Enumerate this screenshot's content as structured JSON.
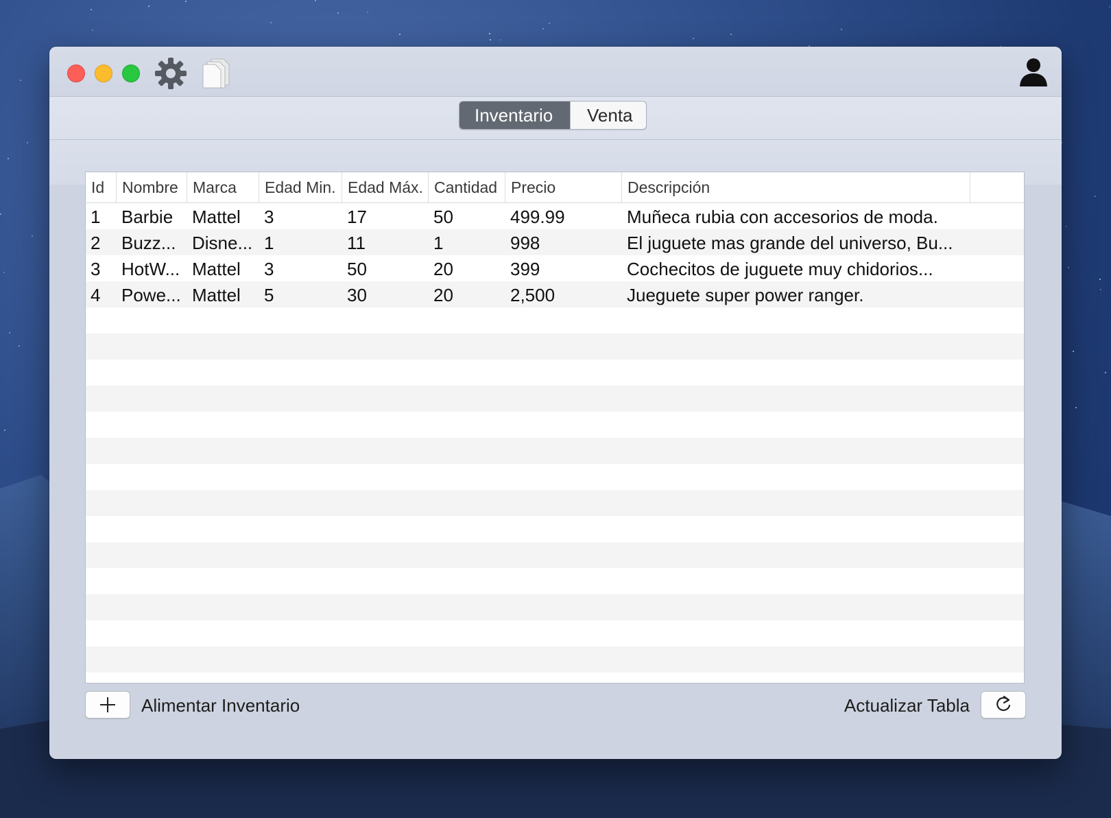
{
  "window": {
    "tabs": [
      {
        "label": "Inventario",
        "selected": true
      },
      {
        "label": "Venta",
        "selected": false
      }
    ]
  },
  "toolbar_icons": [
    "gear-icon",
    "documents-icon",
    "user-icon"
  ],
  "table": {
    "columns": [
      "Id",
      "Nombre",
      "Marca",
      "Edad Min.",
      "Edad Máx.",
      "Cantidad",
      "Precio",
      "Descripción"
    ],
    "rows": [
      [
        "1",
        "Barbie",
        "Mattel",
        "3",
        "17",
        "50",
        "499.99",
        "Muñeca rubia con accesorios de moda."
      ],
      [
        "2",
        "Buzz...",
        "Disne...",
        "1",
        "11",
        "1",
        "998",
        "El juguete mas grande del universo, Bu..."
      ],
      [
        "3",
        "HotW...",
        "Mattel",
        "3",
        "50",
        "20",
        "399",
        "Cochecitos de juguete muy chidorios..."
      ],
      [
        "4",
        "Powe...",
        "Mattel",
        "5",
        "30",
        "20",
        "2,500",
        "Jueguete super power ranger."
      ]
    ]
  },
  "footer": {
    "add_label": "Alimentar Inventario",
    "refresh_label": "Actualizar Tabla"
  }
}
